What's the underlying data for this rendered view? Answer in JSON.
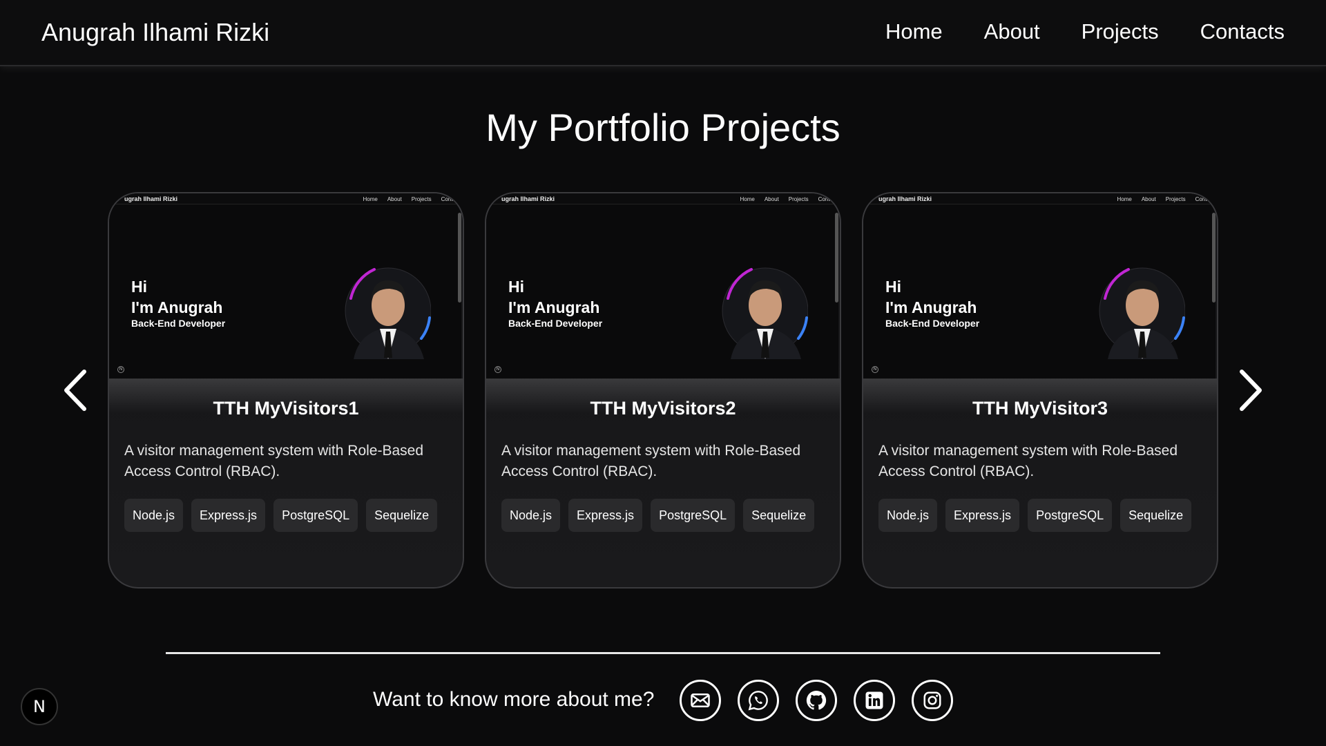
{
  "header": {
    "brand": "Anugrah Ilhami Rizki",
    "nav": [
      "Home",
      "About",
      "Projects",
      "Contacts"
    ]
  },
  "page": {
    "title": "My Portfolio Projects"
  },
  "preview": {
    "brand": "ugrah Ilhami Rizki",
    "nav": [
      "Home",
      "About",
      "Projects",
      "Conta"
    ],
    "greeting_line1": "Hi",
    "greeting_line2": "I'm Anugrah",
    "role": "Back-End Developer"
  },
  "projects": [
    {
      "title": "TTH MyVisitors1",
      "description": "A visitor management system with Role-Based Access Control (RBAC).",
      "tags": [
        "Node.js",
        "Express.js",
        "PostgreSQL",
        "Sequelize"
      ]
    },
    {
      "title": "TTH MyVisitors2",
      "description": "A visitor management system with Role-Based Access Control (RBAC).",
      "tags": [
        "Node.js",
        "Express.js",
        "PostgreSQL",
        "Sequelize"
      ]
    },
    {
      "title": "TTH MyVisitor3",
      "description": "A visitor management system with Role-Based Access Control (RBAC).",
      "tags": [
        "Node.js",
        "Express.js",
        "PostgreSQL",
        "Sequelize"
      ]
    }
  ],
  "carousel": {
    "prev_icon": "chevron-left-icon",
    "next_icon": "chevron-right-icon"
  },
  "footer": {
    "contact_text": "Want to know more about me?",
    "socials": [
      "email-icon",
      "whatsapp-icon",
      "github-icon",
      "linkedin-icon",
      "instagram-icon"
    ]
  },
  "badge": {
    "label": "N"
  },
  "colors": {
    "background": "#0b0b0c",
    "card": "#1a1a1c",
    "tag": "#2a2a2c",
    "accent_magenta": "#c026d3",
    "accent_blue": "#3b82f6"
  }
}
